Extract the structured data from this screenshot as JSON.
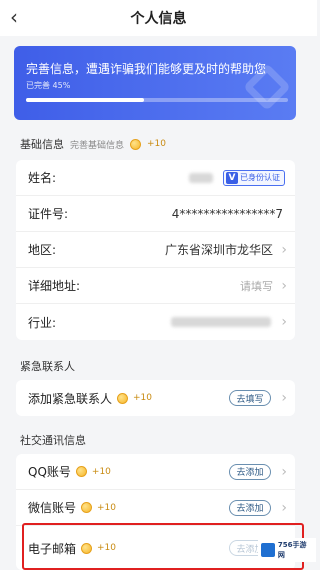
{
  "header": {
    "back_icon": "‹",
    "title": "个人信息"
  },
  "banner": {
    "message": "完善信息，遭遇诈骗我们能够更及时的帮助您",
    "progress_label": "已完善 45%",
    "progress_percent": 45
  },
  "basic": {
    "section_title": "基础信息",
    "section_sub": "完善基础信息",
    "reward": "+10",
    "rows": {
      "name": {
        "label": "姓名:",
        "badge_mark": "V",
        "badge_text": "已身份认证"
      },
      "id": {
        "label": "证件号:",
        "value": "4****************7"
      },
      "region": {
        "label": "地区:",
        "value": "广东省深圳市龙华区"
      },
      "address": {
        "label": "详细地址:",
        "placeholder": "请填写"
      },
      "industry": {
        "label": "行业:"
      }
    }
  },
  "emergency": {
    "section_title": "紧急联系人",
    "add_label": "添加紧急联系人",
    "reward": "+10",
    "button": "去填写"
  },
  "social": {
    "section_title": "社交通讯信息",
    "rows": {
      "qq": {
        "label": "QQ账号",
        "reward": "+10",
        "button": "去添加"
      },
      "wechat": {
        "label": "微信账号",
        "reward": "+10",
        "button": "去添加"
      },
      "email": {
        "label": "电子邮箱",
        "reward": "+10",
        "button": "去添加"
      }
    }
  },
  "watermark": {
    "text": "756手游网"
  },
  "colors": {
    "accent": "#3f5ee8",
    "highlight": "#e02020",
    "reward": "#c98b12"
  }
}
